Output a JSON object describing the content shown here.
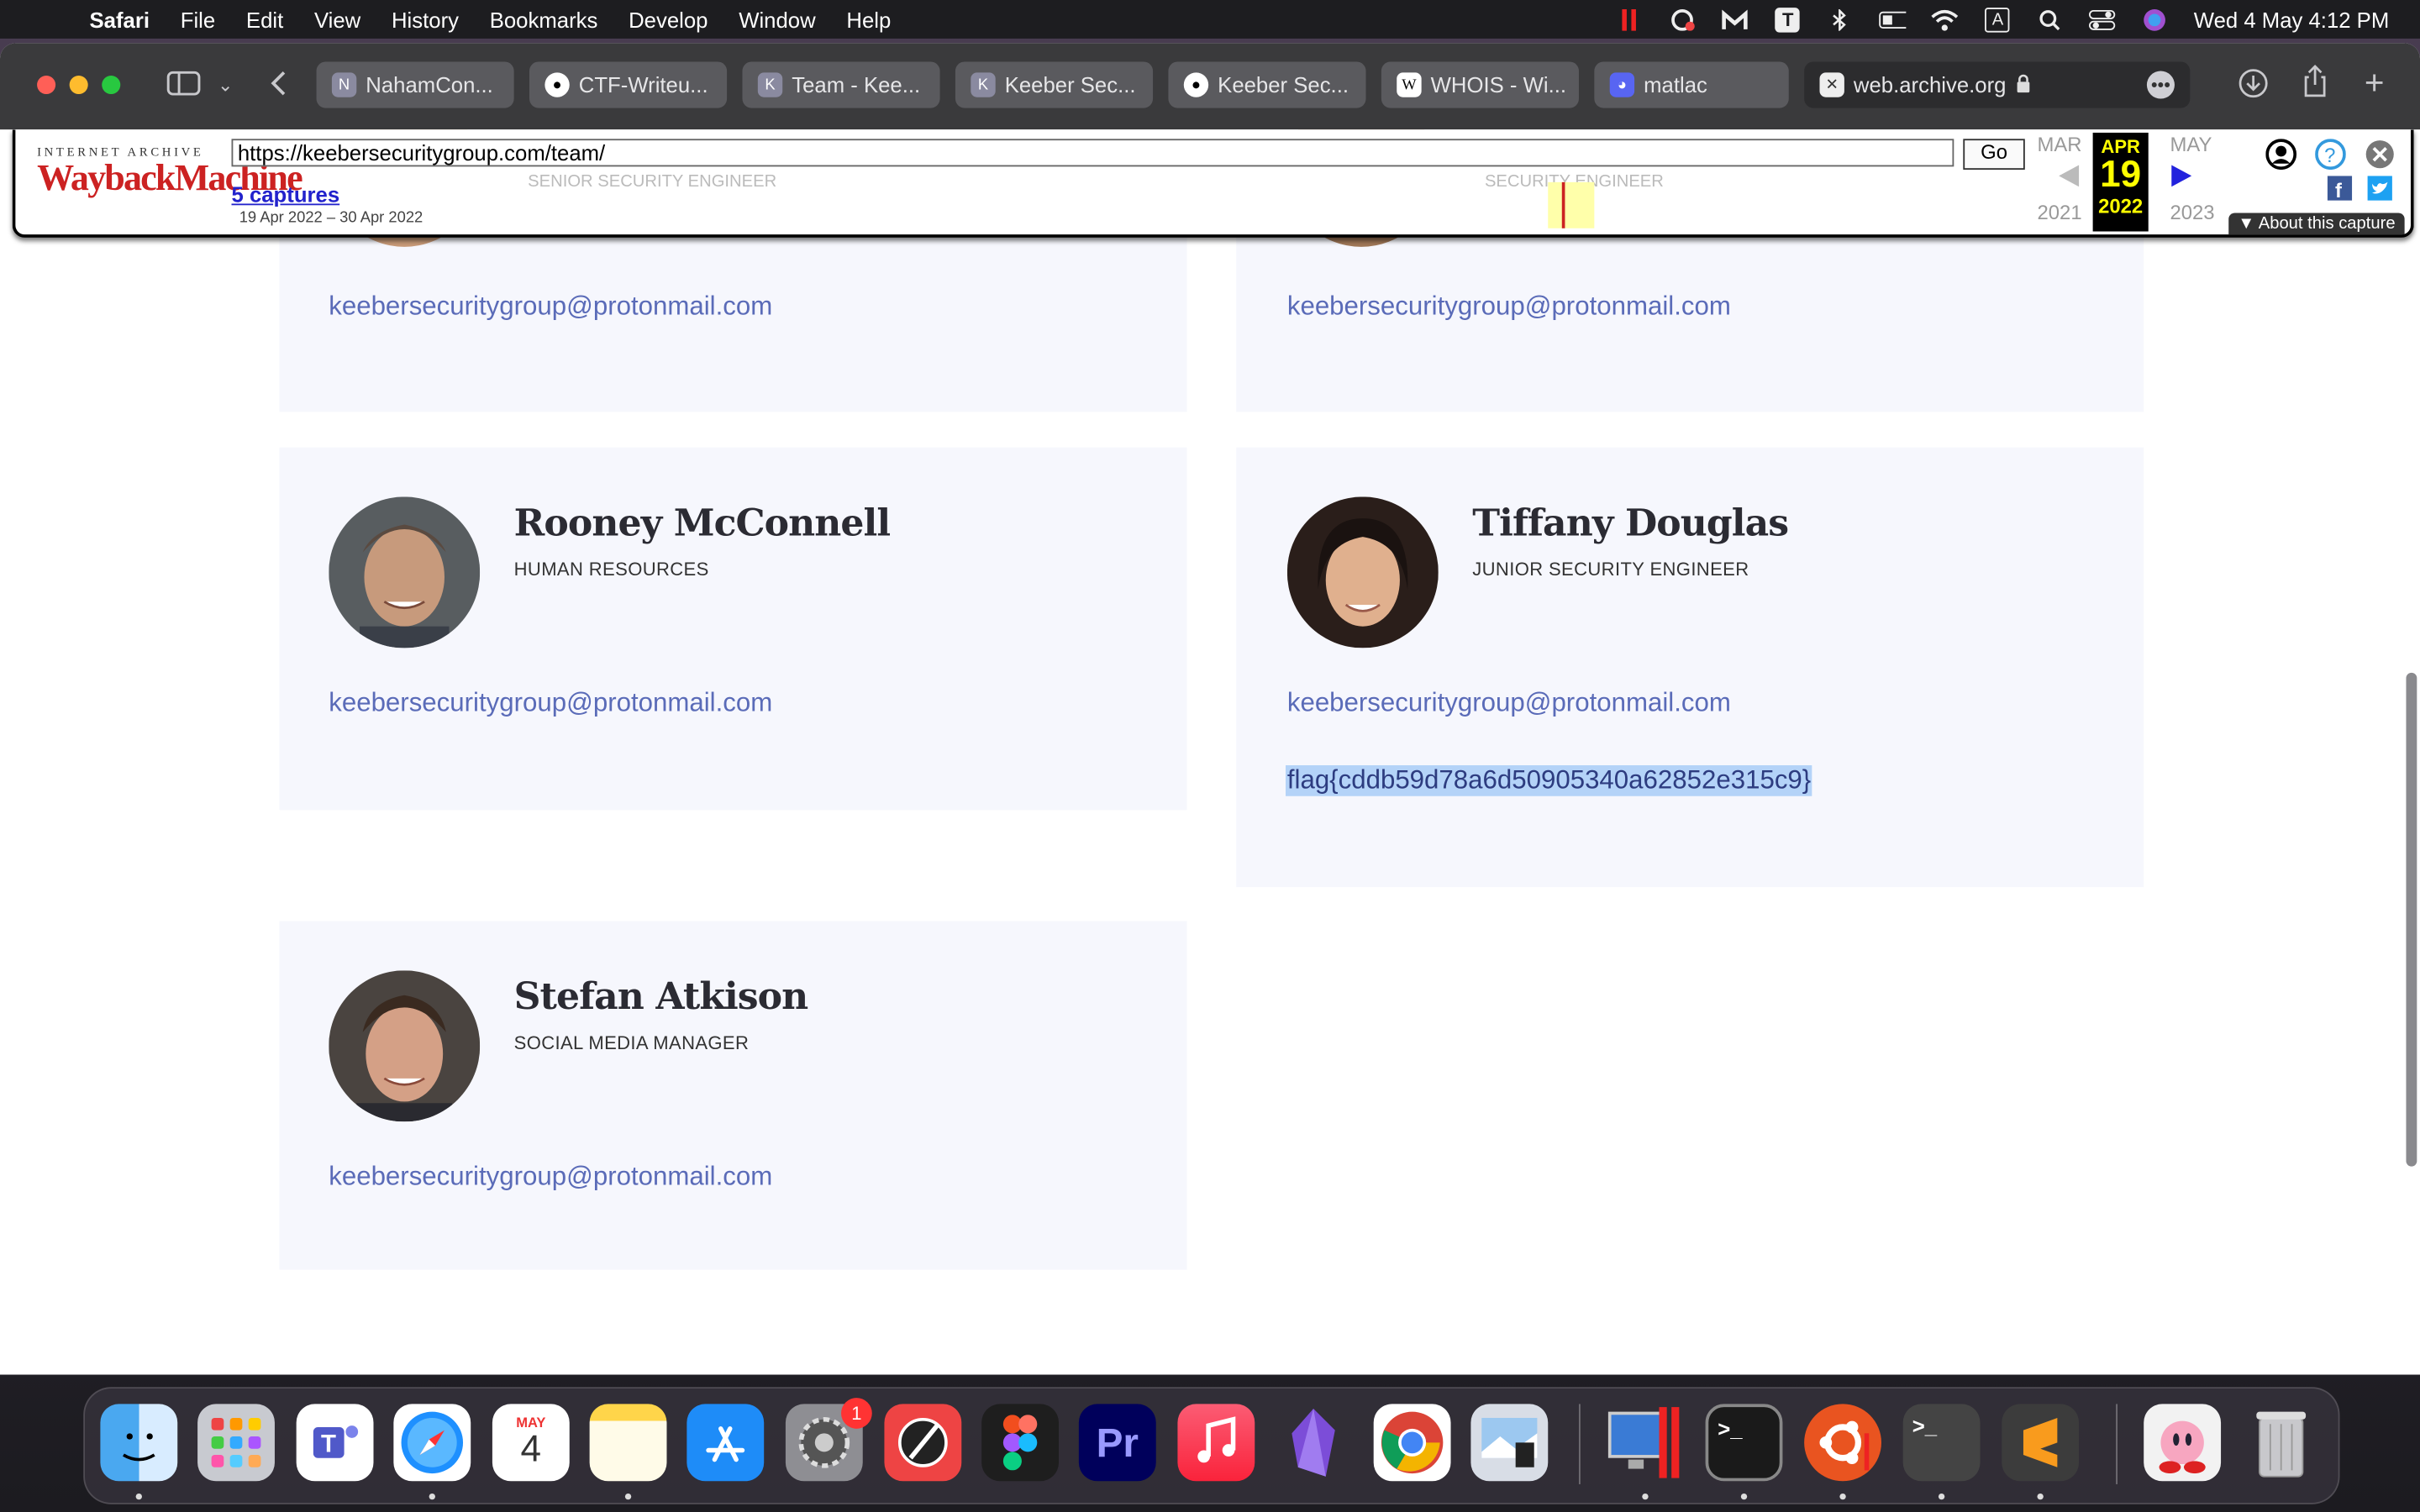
{
  "menubar": {
    "app": "Safari",
    "items": [
      "File",
      "Edit",
      "View",
      "History",
      "Bookmarks",
      "Develop",
      "Window",
      "Help"
    ],
    "datetime": "Wed 4 May  4:12 PM",
    "keyboard_indicator": "A",
    "t_icon": "T"
  },
  "tabs": [
    {
      "label": "NahamCon...",
      "favicon": "N"
    },
    {
      "label": "CTF-Writeu...",
      "favicon": "github"
    },
    {
      "label": "Team - Kee...",
      "favicon": "K"
    },
    {
      "label": "Keeber Sec...",
      "favicon": "K"
    },
    {
      "label": "Keeber Sec...",
      "favicon": "github"
    },
    {
      "label": "WHOIS - Wi...",
      "favicon": "W"
    },
    {
      "label": "matlac",
      "favicon": "discord"
    }
  ],
  "active_tab": {
    "label": "web.archive.org"
  },
  "wayback": {
    "logo_top": "INTERNET ARCHIVE",
    "logo_main": "WaybackMachine",
    "url": "https://keebersecuritygroup.com/team/",
    "go": "Go",
    "captures": "5 captures",
    "range": "19 Apr 2022 – 30 Apr 2022",
    "prev_month": "MAR",
    "cur_month": "APR",
    "cur_day": "19",
    "cur_year": "2022",
    "next_month": "MAY",
    "prev_year": "2021",
    "next_year": "2023",
    "about": "▼ About this capture",
    "behind_roles": [
      "SENIOR SECURITY ENGINEER",
      "SECURITY ENGINEER"
    ]
  },
  "team": {
    "top_left_email": "keebersecuritygroup@protonmail.com",
    "top_right_email": "keebersecuritygroup@protonmail.com",
    "members": [
      {
        "name": "Rooney McConnell",
        "role": "HUMAN RESOURCES",
        "email": "keebersecuritygroup@protonmail.com"
      },
      {
        "name": "Tiffany Douglas",
        "role": "JUNIOR SECURITY ENGINEER",
        "email": "keebersecuritygroup@protonmail.com",
        "flag": "flag{cddb59d78a6d50905340a62852e315c9}"
      },
      {
        "name": "Stefan Atkison",
        "role": "SOCIAL MEDIA MANAGER",
        "email": "keebersecuritygroup@protonmail.com"
      }
    ]
  },
  "dock": {
    "calendar_month": "MAY",
    "calendar_day": "4",
    "settings_badge": "1",
    "premiere": "Pr",
    "terminal": ">_"
  },
  "colors": {
    "card_bg": "#f6f7fd",
    "email": "#5a6bb8",
    "flag_highlight": "#b4d3f8",
    "wayback_red": "#cc2222"
  }
}
